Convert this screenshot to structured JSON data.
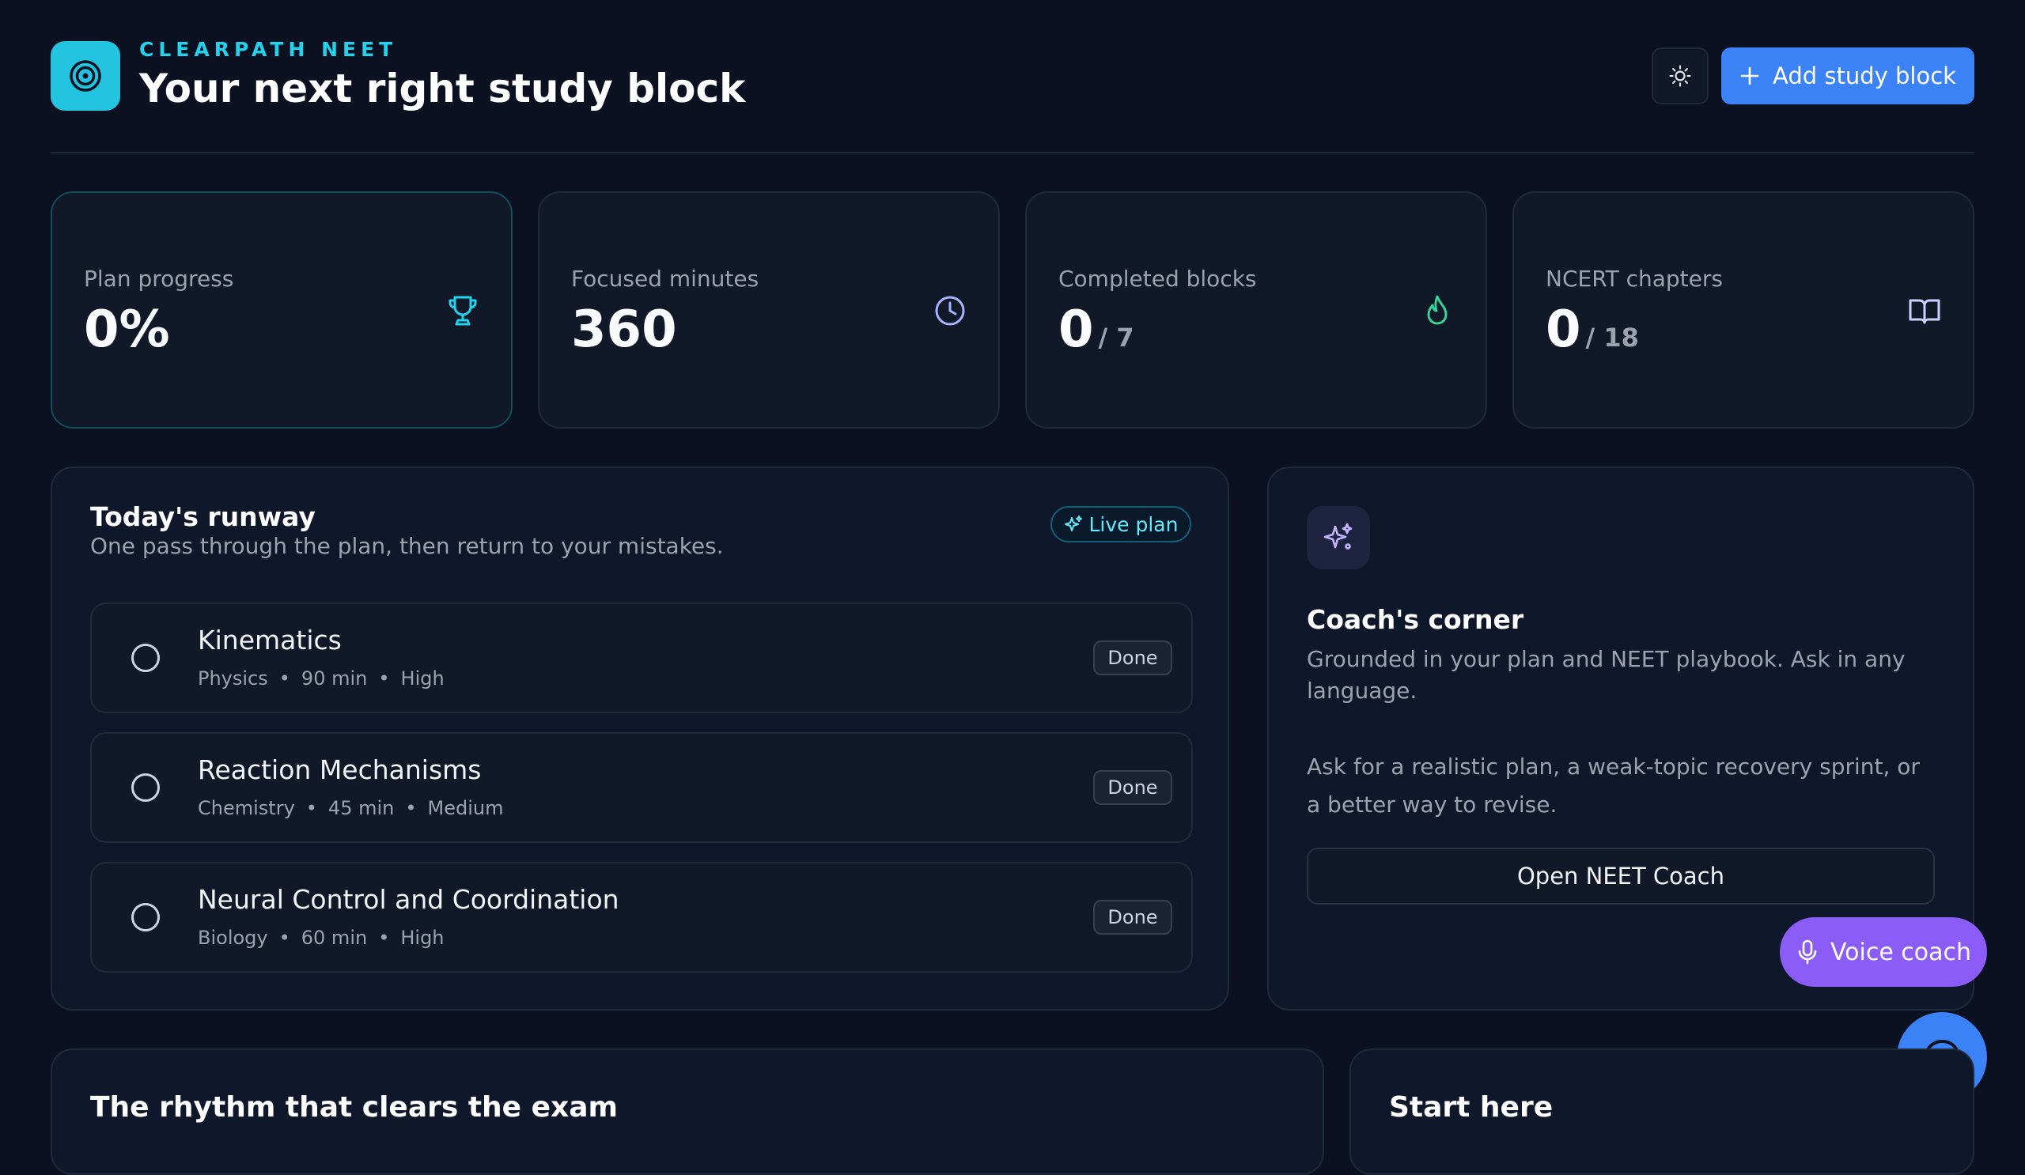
{
  "header": {
    "brand": "CLEARPATH NEET",
    "title": "Your next right study block",
    "add_button": "Add study block"
  },
  "stats": [
    {
      "label": "Plan progress",
      "value": "0%",
      "sub": "",
      "icon": "trophy-icon"
    },
    {
      "label": "Focused minutes",
      "value": "360",
      "sub": "",
      "icon": "clock-icon"
    },
    {
      "label": "Completed blocks",
      "value": "0",
      "sub": "/ 7",
      "icon": "flame-icon"
    },
    {
      "label": "NCERT chapters",
      "value": "0",
      "sub": "/ 18",
      "icon": "book-icon"
    }
  ],
  "runway": {
    "title": "Today's runway",
    "subtitle": "One pass through the plan, then return to your mistakes.",
    "badge": "Live plan",
    "done_label": "Done",
    "tasks": [
      {
        "title": "Kinematics",
        "subject": "Physics",
        "duration": "90 min",
        "priority": "High"
      },
      {
        "title": "Reaction Mechanisms",
        "subject": "Chemistry",
        "duration": "45 min",
        "priority": "Medium"
      },
      {
        "title": "Neural Control and Coordination",
        "subject": "Biology",
        "duration": "60 min",
        "priority": "High"
      }
    ]
  },
  "coach": {
    "title": "Coach's corner",
    "description": "Grounded in your plan and NEET playbook. Ask in any language.",
    "hint": "Ask for a realistic plan, a weak-topic recovery sprint, or a better way to revise.",
    "open_button": "Open NEET Coach"
  },
  "voice_button": "Voice coach",
  "bottom": {
    "left_title": "The rhythm that clears the exam",
    "right_title": "Start here"
  },
  "colors": {
    "background": "#0b1120",
    "accent_cyan": "#22c4e0",
    "accent_blue": "#3b82f6",
    "accent_violet": "#8b5cf6",
    "flame_green": "#34d399"
  }
}
